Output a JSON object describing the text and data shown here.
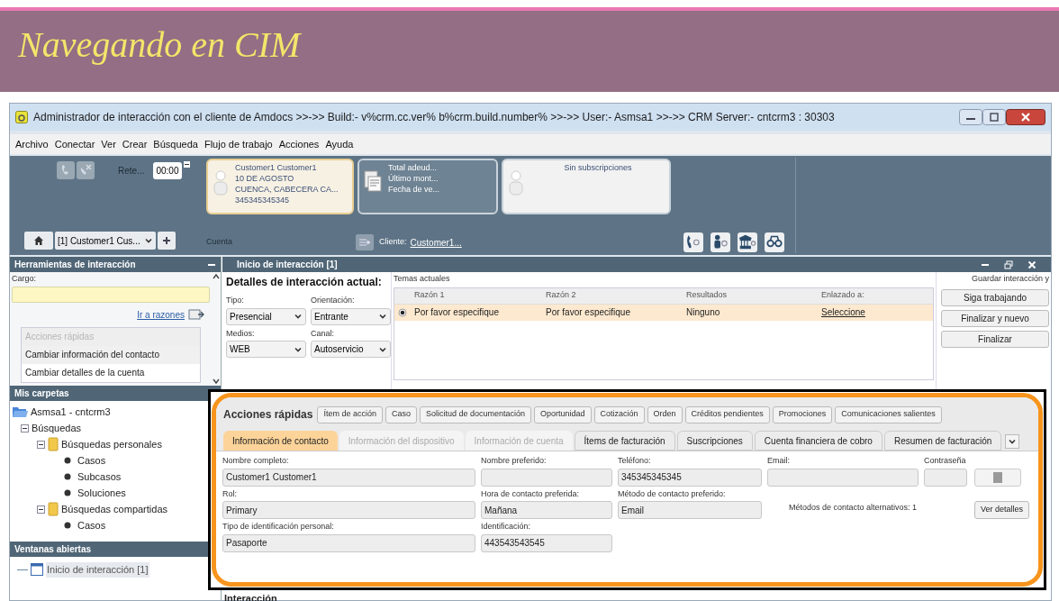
{
  "slide_title": "Navegando en CIM",
  "window": {
    "title": "Administrador de interacción con el cliente de Amdocs >>->> Build:- v%crm.cc.ver% b%crm.build.number% >>->> User:- Asmsa1 >>->> CRM Server:- cntcrm3 : 30303"
  },
  "menu": [
    "Archivo",
    "Conectar",
    "Ver",
    "Crear",
    "Búsqueda",
    "Flujo de trabajo",
    "Acciones",
    "Ayuda"
  ],
  "toolbar": {
    "timer_label": "Rete...",
    "timer": "00:00",
    "session": "[1] Customer1 Cus...",
    "cards": [
      {
        "kind": "contact",
        "selected": true,
        "lines": [
          "Customer1 Customer1",
          "10 DE AGOSTO",
          "CUENCA, CABECERA CA...",
          "345345345345"
        ]
      },
      {
        "kind": "billing",
        "selected": false,
        "lines": [
          "Total adeud...",
          "Último mont...",
          "Fecha de ve..."
        ]
      },
      {
        "kind": "subscription",
        "selected": false,
        "lines": [
          "Sin subscripciones"
        ]
      }
    ],
    "account_label": "Cuenta",
    "customer_label": "Cliente:",
    "customer_link": "Customer1..."
  },
  "left_panel": {
    "tools_title": "Herramientas de interacción",
    "cargo_label": "Cargo:",
    "reasons_link": "Ir a razones",
    "quick_actions": [
      {
        "label": "Acciones rápidas",
        "disabled": true
      },
      {
        "label": "Cambiar información del contacto",
        "disabled": false
      },
      {
        "label": "Cambiar detalles de la cuenta",
        "disabled": false
      }
    ],
    "folders_title": "Mis carpetas",
    "tree": [
      {
        "label": "Asmsa1 - cntcrm3",
        "kind": "root",
        "children": [
          {
            "label": "Búsquedas",
            "kind": "group",
            "expanded": true,
            "children": [
              {
                "label": "Búsquedas personales",
                "kind": "folder",
                "expanded": true,
                "children": [
                  {
                    "label": "Casos",
                    "kind": "leaf"
                  },
                  {
                    "label": "Subcasos",
                    "kind": "leaf"
                  },
                  {
                    "label": "Soluciones",
                    "kind": "leaf"
                  }
                ]
              },
              {
                "label": "Búsquedas compartidas",
                "kind": "folder",
                "expanded": true,
                "children": [
                  {
                    "label": "Casos",
                    "kind": "leaf"
                  }
                ]
              }
            ]
          }
        ]
      }
    ],
    "open_title": "Ventanas abiertas",
    "open_windows": [
      "Inicio de interacción [1]"
    ]
  },
  "interaction": {
    "title": "Inicio de interacción [1]",
    "details_title": "Detalles de interacción actual:",
    "fields": [
      {
        "label": "Tipo:",
        "value": "Presencial"
      },
      {
        "label": "Orientación:",
        "value": "Entrante"
      },
      {
        "label": "Medios:",
        "value": "WEB"
      },
      {
        "label": "Canal:",
        "value": "Autoservicio"
      }
    ],
    "topics_title": "Temas actuales",
    "topics_columns": [
      "Razón 1",
      "Razón 2",
      "Resultados",
      "Enlazado a:"
    ],
    "topics_rows": [
      {
        "selected": true,
        "cells": [
          "Por favor especifique",
          "Por favor especifique",
          "Ninguno",
          "Seleccione"
        ]
      }
    ],
    "save_title": "Guardar interacción y",
    "save_buttons": [
      "Siga trabajando",
      "Finalizar y nuevo",
      "Finalizar"
    ]
  },
  "quick_bar": {
    "title": "Acciones rápidas",
    "buttons": [
      "Ítem de acción",
      "Caso",
      "Solicitud de documentación",
      "Oportunidad",
      "Cotización",
      "Orden",
      "Créditos pendientes",
      "Promociones",
      "Comunicaciones salientes"
    ]
  },
  "tabs": [
    {
      "label": "Información de contacto",
      "selected": true,
      "disabled": false
    },
    {
      "label": "Información del dispositivo",
      "selected": false,
      "disabled": true
    },
    {
      "label": "Información de cuenta",
      "selected": false,
      "disabled": true
    },
    {
      "label": "Ítems de facturación",
      "selected": false,
      "disabled": false
    },
    {
      "label": "Suscripciones",
      "selected": false,
      "disabled": false
    },
    {
      "label": "Cuenta financiera de cobro",
      "selected": false,
      "disabled": false
    },
    {
      "label": "Resumen de facturación",
      "selected": false,
      "disabled": false
    }
  ],
  "contact_form": {
    "rows": [
      [
        {
          "label": "Nombre completo:",
          "value": "Customer1 Customer1"
        },
        {
          "label": "Nombre preferido:"
        },
        {
          "label": "Teléfono:",
          "value": "345345345345"
        },
        {
          "label": "Email:"
        },
        {
          "label": "Contraseña"
        }
      ],
      [
        {
          "label": "Rol:",
          "value": "Primary"
        },
        {
          "label": "Hora de contacto preferida:",
          "value": "Mañana"
        },
        {
          "label": "Método de contacto preferido:",
          "value": "Email"
        }
      ],
      [
        {
          "label": "Tipo de identificación personal:",
          "value": "Pasaporte"
        },
        {
          "label": "Identificación:",
          "value": "443543543545"
        }
      ]
    ],
    "alternatives_note": "Métodos de contacto alternativos: 1",
    "details_button": "Ver detalles"
  },
  "section_label": "Interacción"
}
